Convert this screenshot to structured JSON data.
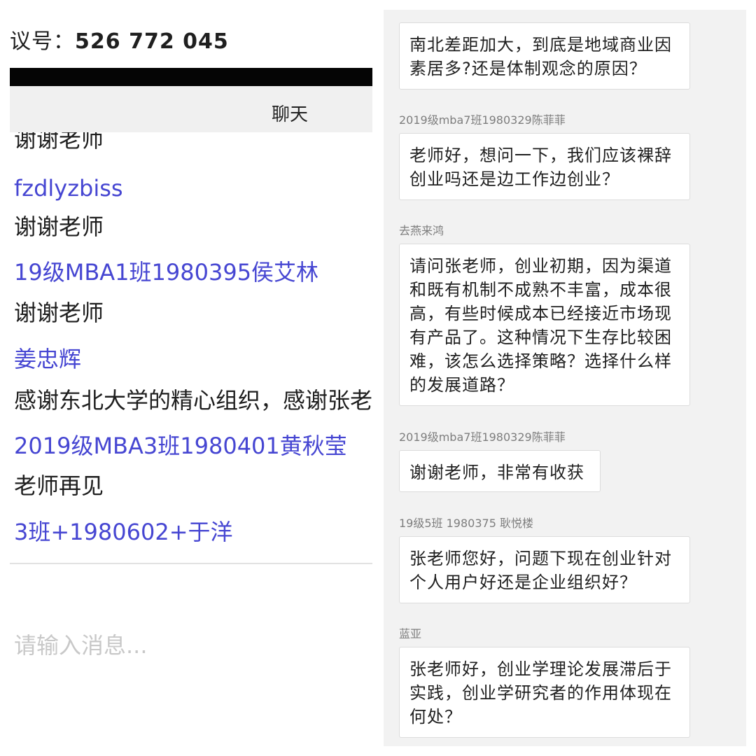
{
  "left": {
    "meeting_label": "议号：",
    "meeting_number": "526 772 045",
    "tab_label": "聊天",
    "messages": [
      {
        "kind": "text",
        "text": "谢谢老师"
      },
      {
        "kind": "sender",
        "text": "fzdlyzbiss"
      },
      {
        "kind": "text",
        "text": "谢谢老师"
      },
      {
        "kind": "sender",
        "text": "19级MBA1班1980395侯艾林"
      },
      {
        "kind": "text",
        "text": "谢谢老师"
      },
      {
        "kind": "sender",
        "text": "姜忠辉"
      },
      {
        "kind": "text",
        "text": "感谢东北大学的精心组织，感谢张老"
      },
      {
        "kind": "sender",
        "text": "2019级MBA3班1980401黄秋莹"
      },
      {
        "kind": "text",
        "text": "老师再见"
      },
      {
        "kind": "sender",
        "text": "3班+1980602+于洋"
      }
    ],
    "input_placeholder": "请输入消息..."
  },
  "right": {
    "questions": [
      {
        "sender": "",
        "text": "南北差距加大，到底是地域商业因素居多?还是体制观念的原因？"
      },
      {
        "sender": "2019级mba7班1980329陈菲菲",
        "text": "老师好，想问一下，我们应该裸辞创业吗还是边工作边创业？"
      },
      {
        "sender": "去燕来鸿",
        "text": "请问张老师，创业初期，因为渠道和既有机制不成熟不丰富，成本很高，有些时候成本已经接近市场现有产品了。这种情况下生存比较困难，该怎么选择策略？选择什么样的发展道路？"
      },
      {
        "sender": "2019级mba7班1980329陈菲菲",
        "text": "谢谢老师，非常有收获"
      },
      {
        "sender": "19级5班 1980375 耿悦楼",
        "text": "张老师您好，问题下现在创业针对个人用户好还是企业组织好？"
      },
      {
        "sender": "蓝亚",
        "text": "张老师好，创业学理论发展滞后于实践，创业学研究者的作用体现在何处？"
      }
    ]
  },
  "colors": {
    "sender_name": "#4646d2",
    "message_text": "#1e1e1e",
    "placeholder": "#c8c8c8",
    "right_background": "#f2f2f2",
    "bubble_border": "#dcdcdc"
  }
}
